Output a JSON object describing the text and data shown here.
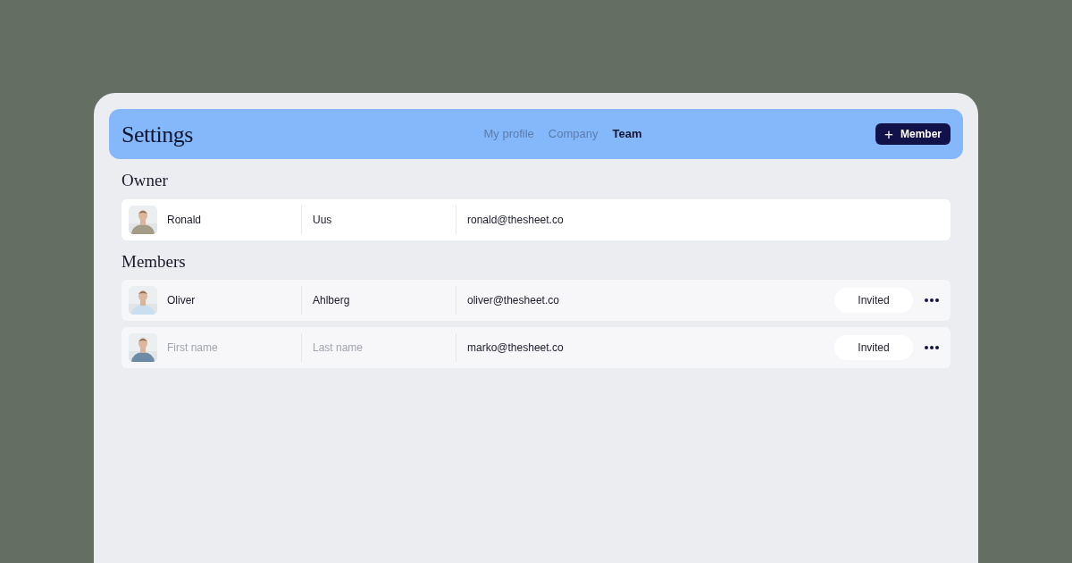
{
  "header": {
    "title": "Settings",
    "tabs": [
      {
        "label": "My profile",
        "selected": false
      },
      {
        "label": "Company",
        "selected": false
      },
      {
        "label": "Team",
        "selected": true
      }
    ],
    "add_button": {
      "icon": "+",
      "label": "Member"
    }
  },
  "sections": [
    {
      "title": "Owner",
      "rows": [
        {
          "kind": "owner",
          "first_name": {
            "value": "Ronald"
          },
          "last_name": {
            "value": "Uus"
          },
          "email": "ronald@thesheet.co"
        }
      ]
    },
    {
      "title": "Members",
      "rows": [
        {
          "kind": "member",
          "first_name": {
            "value": "Oliver"
          },
          "last_name": {
            "value": "Ahlberg"
          },
          "email": "oliver@thesheet.co",
          "status": "Invited"
        },
        {
          "kind": "member",
          "first_name": {
            "placeholder": "First name"
          },
          "last_name": {
            "placeholder": "Last name"
          },
          "email": "marko@thesheet.co",
          "status": "Invited"
        }
      ]
    }
  ]
}
